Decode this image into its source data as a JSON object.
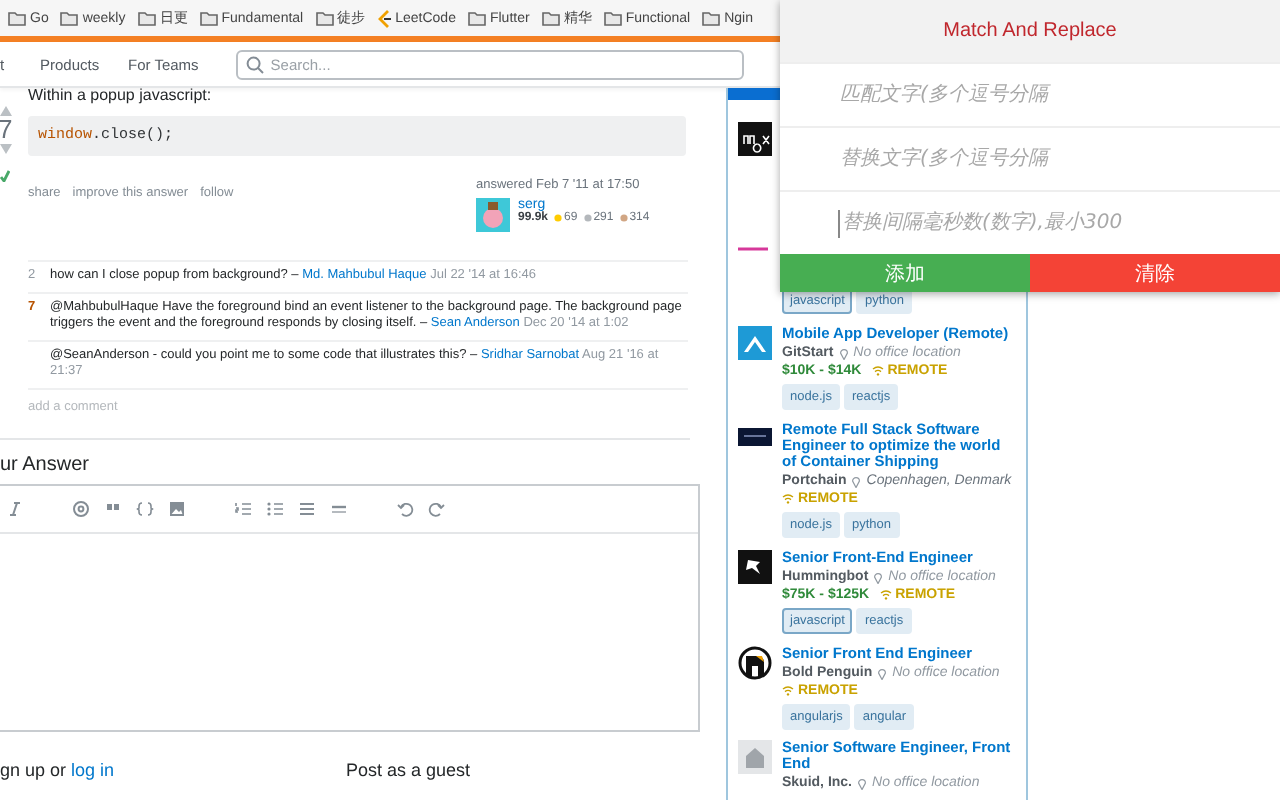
{
  "bookmarks": [
    {
      "label": "Go",
      "kind": "folder"
    },
    {
      "label": "weekly",
      "kind": "folder"
    },
    {
      "label": "日更",
      "kind": "folder"
    },
    {
      "label": "Fundamental",
      "kind": "folder"
    },
    {
      "label": "徒步",
      "kind": "folder"
    },
    {
      "label": "LeetCode",
      "kind": "site"
    },
    {
      "label": "Flutter",
      "kind": "folder"
    },
    {
      "label": "精华",
      "kind": "folder"
    },
    {
      "label": "Functional",
      "kind": "folder"
    },
    {
      "label": "Ngin",
      "kind": "folder"
    }
  ],
  "nav": {
    "items": [
      "t",
      "Products",
      "For Teams"
    ],
    "search": {
      "placeholder": "Search..."
    }
  },
  "answer": {
    "intro": "Within a popup javascript:",
    "votes": "7",
    "accepted": true,
    "code": [
      {
        "text": "window",
        "kind": "keyword"
      },
      {
        "text": ".close();",
        "kind": "plain"
      }
    ],
    "actions": [
      "share",
      "improve this answer",
      "follow"
    ],
    "answered": "answered Feb 7 '11 at 17:50",
    "user": {
      "name": "serg",
      "reputation": "99.9k",
      "badges": [
        {
          "kind": "gold",
          "count": "69"
        },
        {
          "kind": "silver",
          "count": "291"
        },
        {
          "kind": "bronze",
          "count": "314"
        }
      ]
    }
  },
  "comments": [
    {
      "score": "2",
      "popular": false,
      "text": "how can I close popup from background? –",
      "user": "Md. Mahbubul Haque",
      "date": "Jul 22 '14 at 16:46"
    },
    {
      "score": "7",
      "popular": true,
      "text": "@MahbubulHaque Have the foreground bind an event listener to the background page. The background page triggers the event and the foreground responds by closing itself. –",
      "user": "Sean Anderson",
      "date": "Dec 20 '14 at 1:02"
    },
    {
      "text": "@SeanAnderson - could you point me to some code that illustrates this? –",
      "user": "Sridhar Sarnobat",
      "date": "Aug 21 '16 at 21:37"
    }
  ],
  "add_comment": "add a comment",
  "your_answer": "ur Answer",
  "signup": {
    "text": "gn up or",
    "link": "log in"
  },
  "guest": "Post as a guest",
  "jobs": [
    {
      "tags": [
        {
          "label": "javascript",
          "watched": true
        },
        {
          "label": "python",
          "watched": false
        }
      ]
    },
    {
      "title": "Mobile App Developer (Remote)",
      "company": "GitStart",
      "location": "No office location",
      "location_known": false,
      "salary": "$10K - $14K",
      "remote": "REMOTE",
      "tags": [
        {
          "label": "node.js",
          "watched": false
        },
        {
          "label": "reactjs",
          "watched": false
        }
      ]
    },
    {
      "title": "Remote Full Stack Software Engineer to optimize the world of Container Shipping",
      "company": "Portchain",
      "location": "Copenhagen, Denmark",
      "location_known": true,
      "remote": "REMOTE",
      "tags": [
        {
          "label": "node.js",
          "watched": false
        },
        {
          "label": "python",
          "watched": false
        }
      ]
    },
    {
      "title": "Senior Front-End Engineer",
      "company": "Hummingbot",
      "location": "No office location",
      "location_known": false,
      "salary": "$75K - $125K",
      "remote": "REMOTE",
      "tags": [
        {
          "label": "javascript",
          "watched": true
        },
        {
          "label": "reactjs",
          "watched": false
        }
      ]
    },
    {
      "title": "Senior Front End Engineer",
      "company": "Bold Penguin",
      "location": "No office location",
      "location_known": false,
      "remote": "REMOTE",
      "tags": [
        {
          "label": "angularjs",
          "watched": false
        },
        {
          "label": "angular",
          "watched": false
        }
      ]
    },
    {
      "title": "Senior Software Engineer, Front End",
      "company": "Skuid, Inc.",
      "location": "No office location",
      "location_known": false
    }
  ],
  "popup": {
    "title": "Match And Replace",
    "fields": [
      {
        "placeholder": "匹配文字(多个逗号分隔",
        "focused": false
      },
      {
        "placeholder": "替换文字(多个逗号分隔",
        "focused": false
      },
      {
        "placeholder": "替换间隔毫秒数(数字),最小300",
        "focused": true
      }
    ],
    "buttons": [
      {
        "label": "添加",
        "kind": "add"
      },
      {
        "label": "清除",
        "kind": "clear"
      }
    ]
  }
}
